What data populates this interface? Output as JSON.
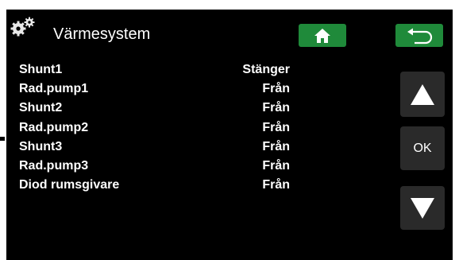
{
  "header": {
    "icon": "gears-icon",
    "title": "Värmesystem",
    "home_icon": "home-icon",
    "back_icon": "return-arrow-icon"
  },
  "rows": [
    {
      "label": "Shunt1",
      "value": "Stänger"
    },
    {
      "label": "Rad.pump1",
      "value": "Från"
    },
    {
      "label": "Shunt2",
      "value": "Från"
    },
    {
      "label": "Rad.pump2",
      "value": "Från"
    },
    {
      "label": "Shunt3",
      "value": "Från"
    },
    {
      "label": "Rad.pump3",
      "value": "Från"
    },
    {
      "label": "Diod rumsgivare",
      "value": "Från"
    }
  ],
  "side_buttons": {
    "up_icon": "triangle-up-icon",
    "ok_label": "OK",
    "down_icon": "triangle-down-icon"
  },
  "colors": {
    "background": "#000000",
    "button_green": "#1f8a3a",
    "side_button": "#2a2a2a",
    "text": "#ffffff"
  }
}
